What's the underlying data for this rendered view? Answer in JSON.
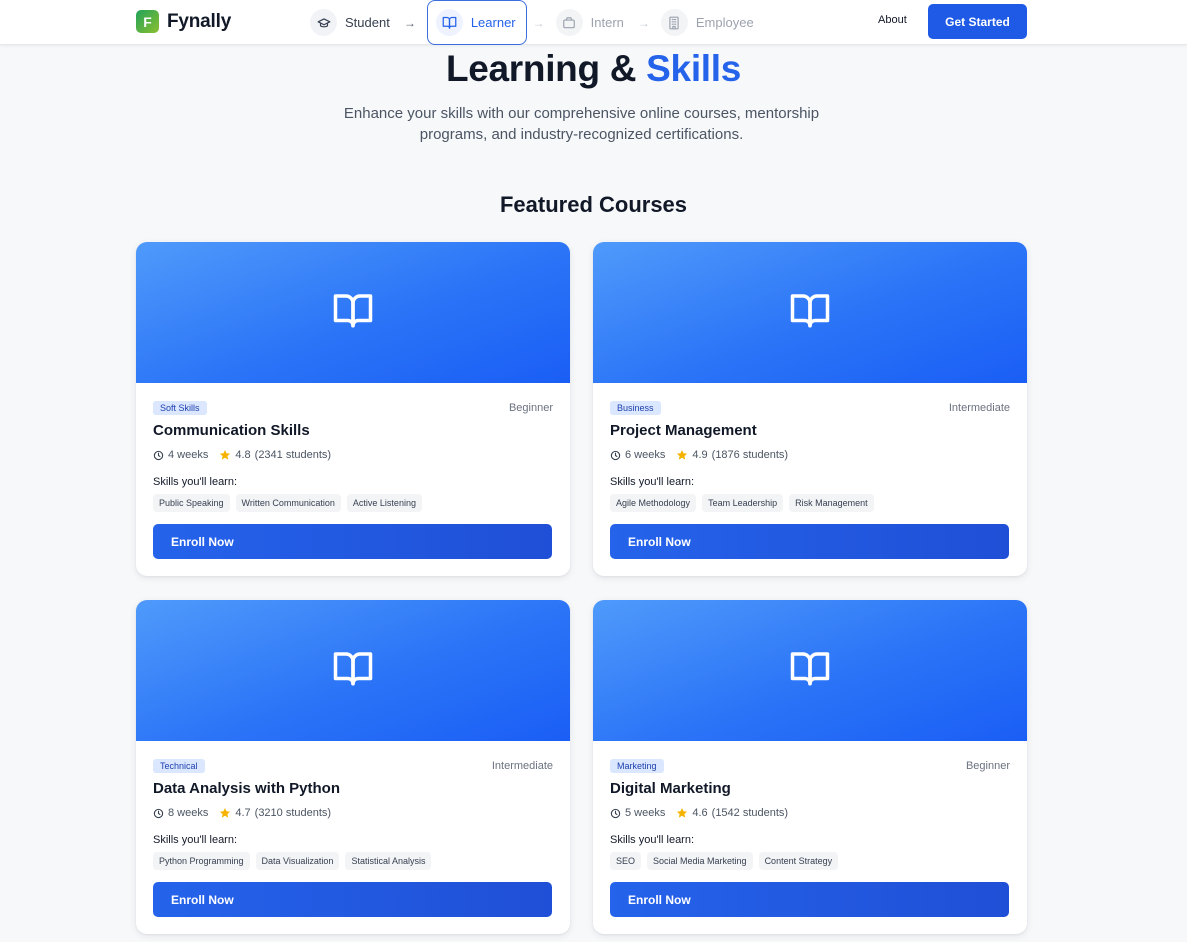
{
  "brand": {
    "logo_letter": "F",
    "name": "Fynally"
  },
  "nav": {
    "steps": [
      {
        "label": "Student",
        "icon": "graduation-cap-icon",
        "state": "done"
      },
      {
        "label": "Learner",
        "icon": "book-open-icon",
        "state": "active"
      },
      {
        "label": "Intern",
        "icon": "briefcase-icon",
        "state": "upcoming"
      },
      {
        "label": "Employee",
        "icon": "building-icon",
        "state": "upcoming"
      }
    ],
    "arrow": "→",
    "about": "About",
    "cta": "Get Started"
  },
  "hero": {
    "title_main": "Learning &",
    "title_accent": "Skills",
    "subtitle": "Enhance your skills with our comprehensive online courses, mentorship programs, and industry-recognized certifications."
  },
  "featured": {
    "title": "Featured Courses",
    "skills_label": "Skills you'll learn:",
    "enroll_label": "Enroll Now",
    "courses": [
      {
        "category": "Soft Skills",
        "level": "Beginner",
        "title": "Communication Skills",
        "duration": "4 weeks",
        "rating": "4.8",
        "students": "(2341 students)",
        "skills": [
          "Public Speaking",
          "Written Communication",
          "Active Listening"
        ]
      },
      {
        "category": "Business",
        "level": "Intermediate",
        "title": "Project Management",
        "duration": "6 weeks",
        "rating": "4.9",
        "students": "(1876 students)",
        "skills": [
          "Agile Methodology",
          "Team Leadership",
          "Risk Management"
        ]
      },
      {
        "category": "Technical",
        "level": "Intermediate",
        "title": "Data Analysis with Python",
        "duration": "8 weeks",
        "rating": "4.7",
        "students": "(3210 students)",
        "skills": [
          "Python Programming",
          "Data Visualization",
          "Statistical Analysis"
        ]
      },
      {
        "category": "Marketing",
        "level": "Beginner",
        "title": "Digital Marketing",
        "duration": "5 weeks",
        "rating": "4.6",
        "students": "(1542 students)",
        "skills": [
          "SEO",
          "Social Media Marketing",
          "Content Strategy"
        ]
      }
    ]
  },
  "colors": {
    "accent": "#2563eb",
    "star": "#f5b300",
    "banner": "#2b74f7"
  }
}
